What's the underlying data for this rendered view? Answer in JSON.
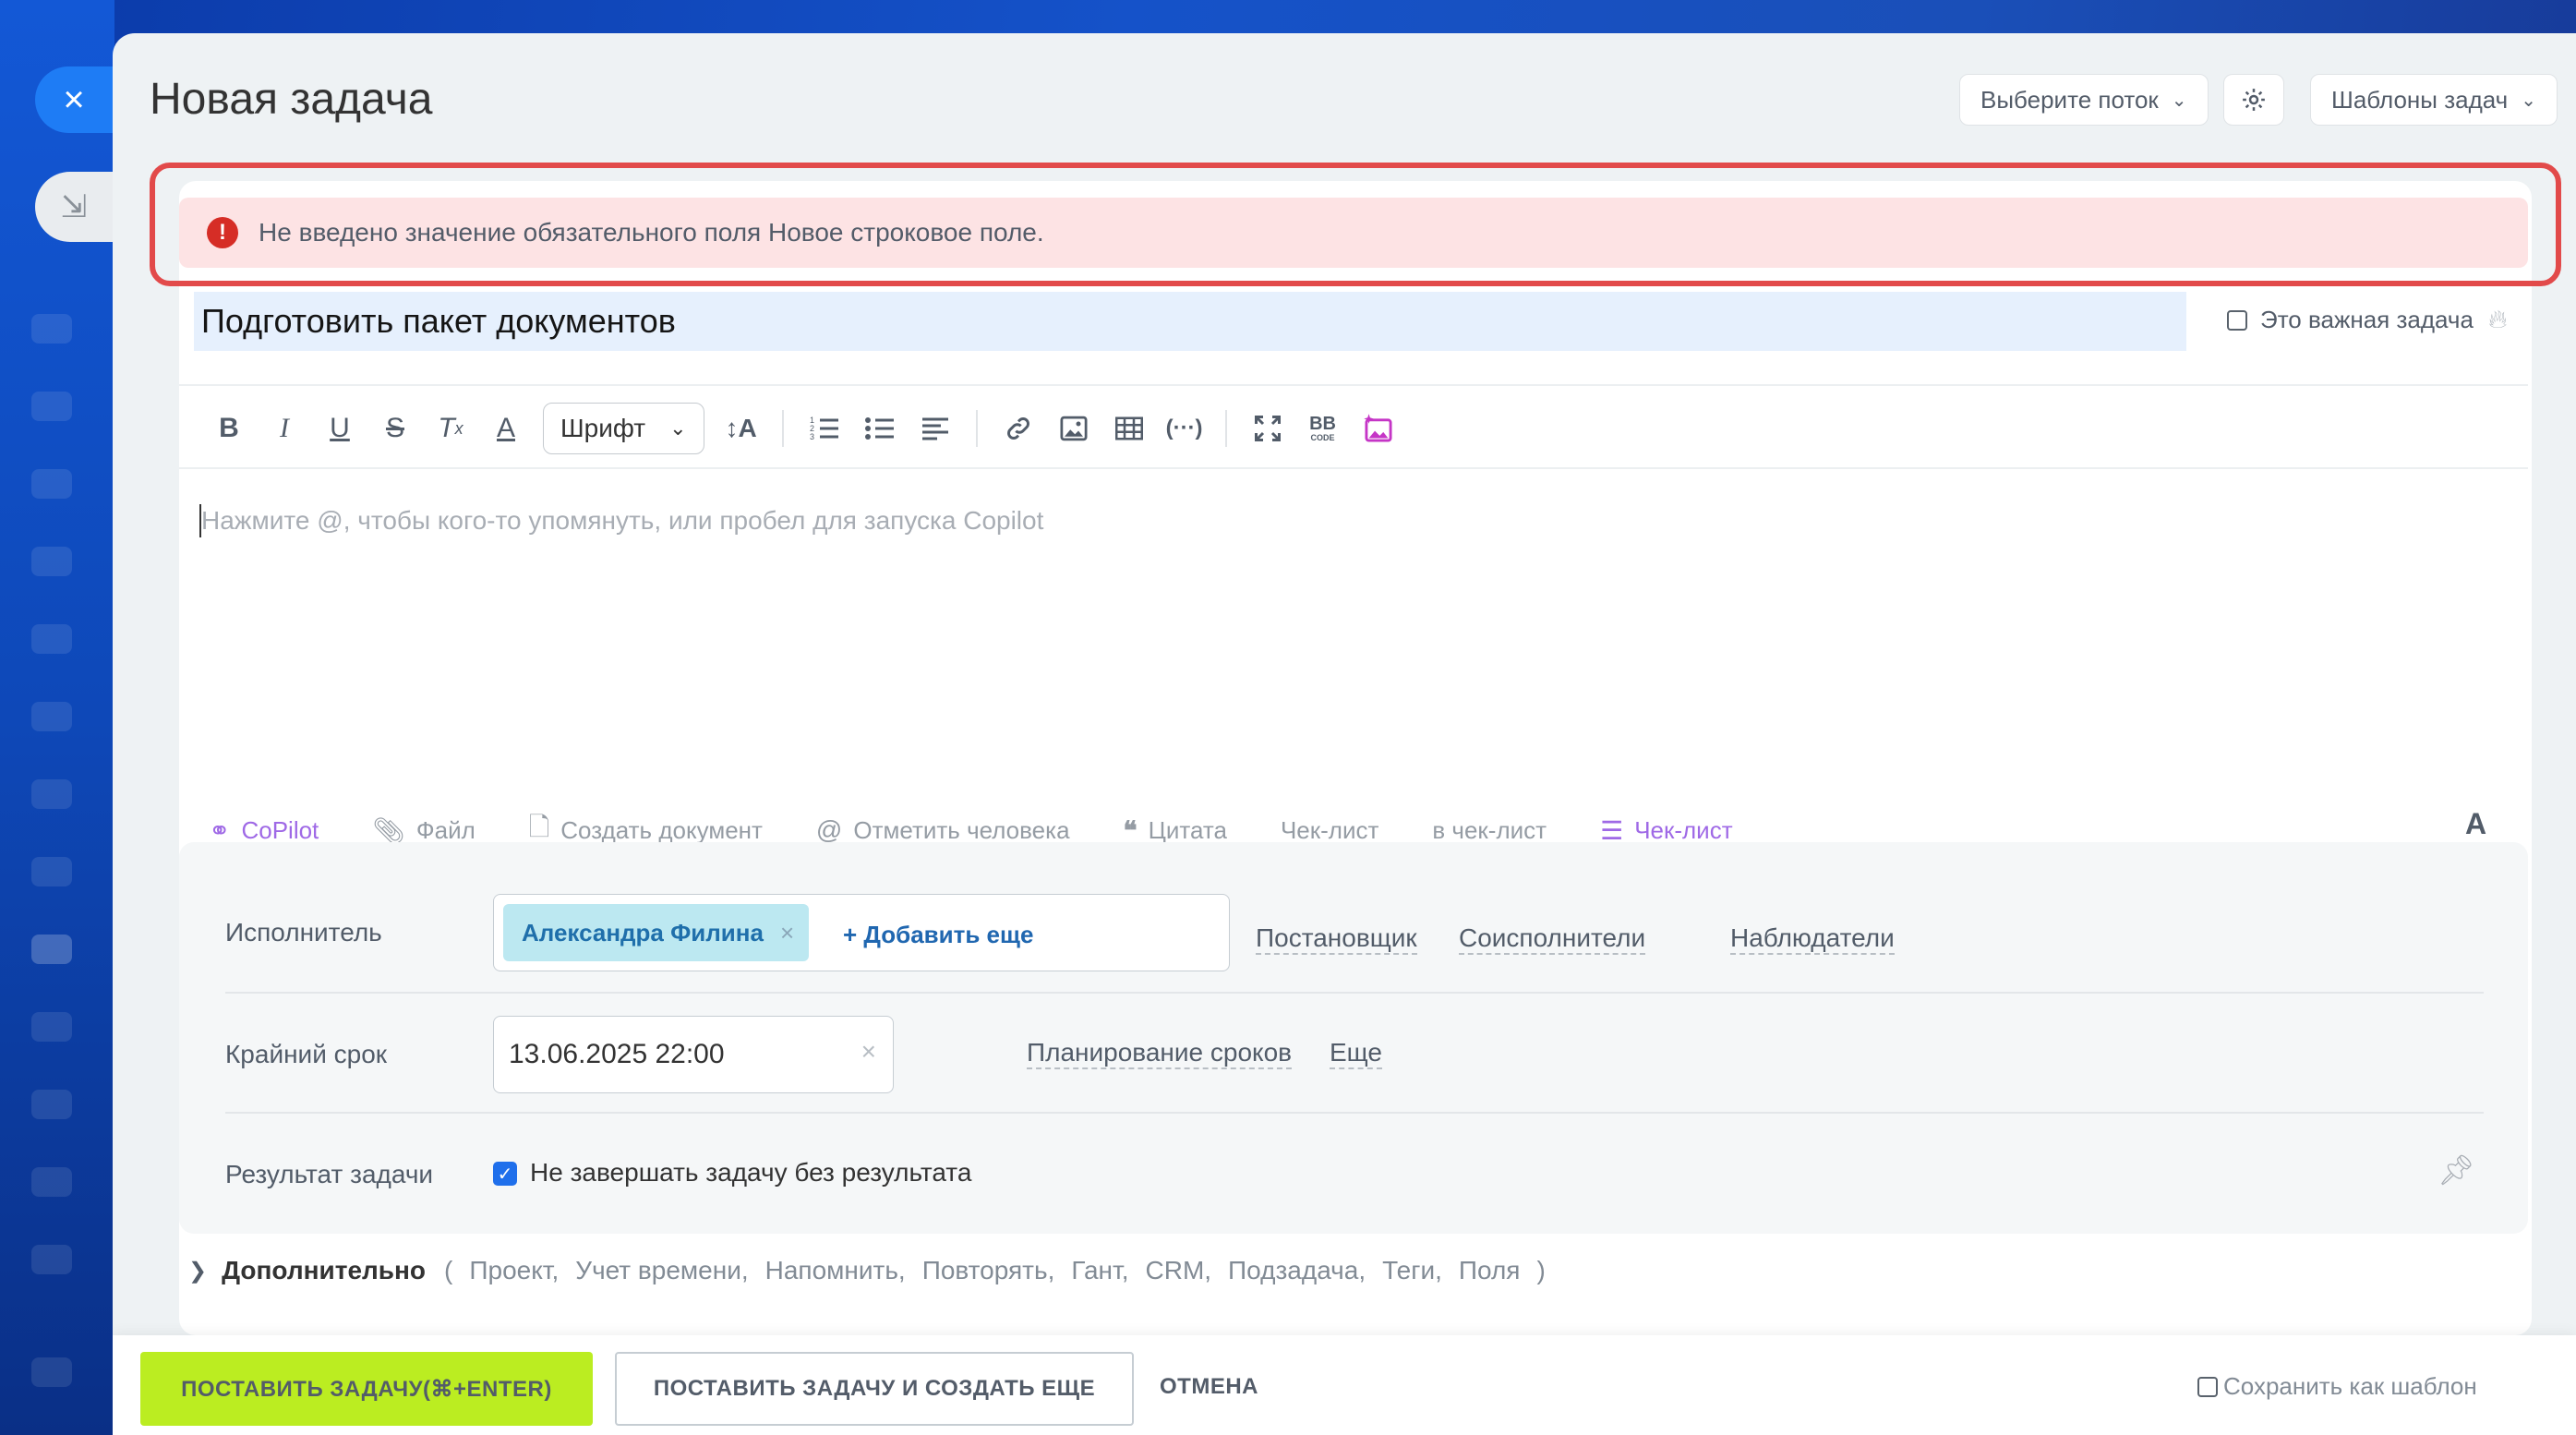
{
  "window": {
    "close_icon": "×",
    "collapse_icon": "⇲"
  },
  "header": {
    "title": "Новая задача",
    "flow_select": "Выберите поток",
    "settings_icon": "gear-icon",
    "templates": "Шаблоны задач"
  },
  "error": {
    "message": "Не введено значение обязательного поля Новое строковое поле.",
    "color": "#e24a4a"
  },
  "task": {
    "title": "Подготовить пакет документов",
    "important_label": "Это важная задача"
  },
  "editor": {
    "font_label": "Шрифт",
    "placeholder": "Нажмите @, чтобы кого-то упомянуть, или пробел для запуска Copilot",
    "bbcode_label": "BB"
  },
  "attachments": {
    "copilot": "CoPilot",
    "file": "Файл",
    "create_doc": "Создать документ",
    "mention": "Отметить человека",
    "quote": "Цитата",
    "checklist1": "Чек-лист",
    "to_checklist": "в чек-лист",
    "checklist2": "Чек-лист",
    "format_letter": "A"
  },
  "fields": {
    "assignee_label": "Исполнитель",
    "assignee_name": "Александра Филина",
    "add_more": "+ Добавить еще",
    "creator": "Постановщик",
    "coassignees": "Соисполнители",
    "observers": "Наблюдатели",
    "deadline_label": "Крайний срок",
    "deadline_value": "13.06.2025 22:00",
    "planning": "Планирование сроков",
    "more": "Еще",
    "result_label": "Результат задачи",
    "result_checkbox": "Не завершать задачу без результата"
  },
  "extra": {
    "label": "Дополнительно",
    "open_paren": "(",
    "items": [
      "Проект,",
      "Учет времени,",
      "Напомнить,",
      "Повторять,",
      "Гант,",
      "CRM,",
      "Подзадача,",
      "Теги,",
      "Поля"
    ],
    "close_paren": ")"
  },
  "footer": {
    "submit": "ПОСТАВИТЬ ЗАДАЧУ(⌘+ENTER)",
    "submit_and_new": "ПОСТАВИТЬ ЗАДАЧУ И СОЗДАТЬ ЕЩЕ",
    "cancel": "ОТМЕНА",
    "save_template": "Сохранить как шаблон"
  },
  "colors": {
    "accent_green": "#bbed21",
    "link_blue": "#2067b0",
    "chip_bg": "#bce8f1"
  }
}
